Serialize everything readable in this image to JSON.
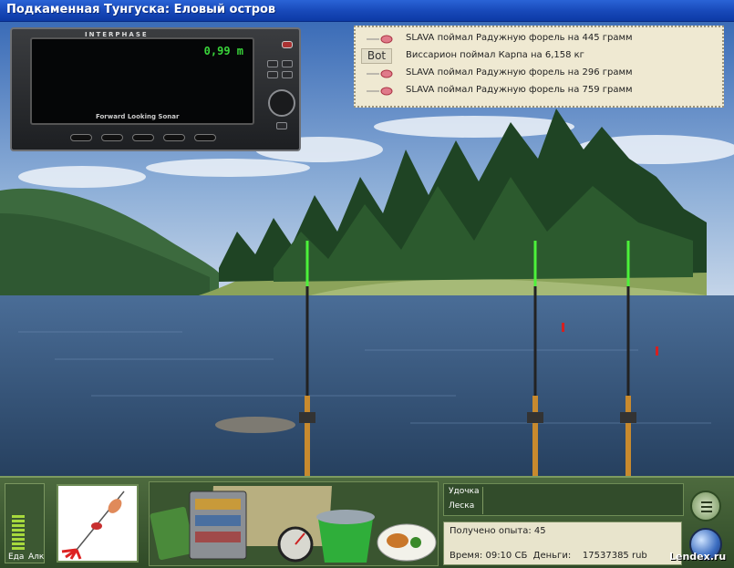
{
  "window": {
    "title": "Подкаменная Тунгуска: Еловый остров"
  },
  "sonar": {
    "brand": "INTERPHASE",
    "depth": "0,99 m",
    "caption": "Forward Looking Sonar"
  },
  "chat": {
    "entries": [
      {
        "icon": "lure-icon",
        "text": "SLAVA поймал Радужную форель на 445 грамм"
      },
      {
        "icon": "bot-tag",
        "tag": "Bot",
        "text": "Виссарион поймал Карпа на 6,158 кг"
      },
      {
        "icon": "lure-icon",
        "text": "SLAVA поймал Радужную форель на 296 грамм"
      },
      {
        "icon": "lure-icon",
        "text": "SLAVA поймал Радужную форель на 759 грамм"
      }
    ]
  },
  "panel": {
    "meter_labels": [
      "Еда",
      "Алк"
    ],
    "meter_level": 0.6,
    "tackle_labels": {
      "rod": "Удочка",
      "line": "Леска"
    },
    "experience": "Получено опыта: 45",
    "status": "Время: 09:10 СБ  Деньги:    17537385 rub"
  },
  "watermark": "Lendex.ru",
  "colors": {
    "titlebar": "#1748b8",
    "panel": "#3e5a32",
    "rod_tip": "#4cf23a"
  }
}
